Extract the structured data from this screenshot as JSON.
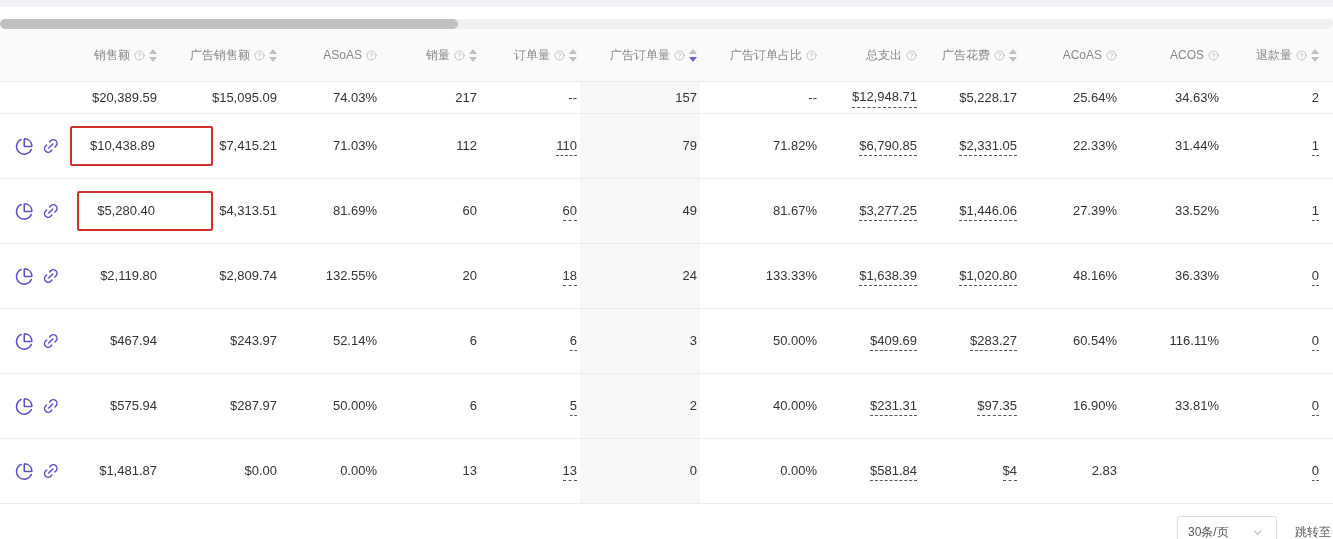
{
  "columns": [
    {
      "label": "销售额",
      "sortable": true,
      "sorted": false
    },
    {
      "label": "广告销售额",
      "sortable": true,
      "sorted": false
    },
    {
      "label": "ASoAS",
      "sortable": false
    },
    {
      "label": "销量",
      "sortable": true,
      "sorted": false
    },
    {
      "label": "订单量",
      "sortable": true,
      "sorted": false
    },
    {
      "label": "广告订单量",
      "sortable": true,
      "sorted": true
    },
    {
      "label": "广告订单占比",
      "sortable": false
    },
    {
      "label": "总支出",
      "sortable": false
    },
    {
      "label": "广告花费",
      "sortable": true,
      "sorted": false
    },
    {
      "label": "ACoAS",
      "sortable": false
    },
    {
      "label": "ACOS",
      "sortable": false
    },
    {
      "label": "退款量",
      "sortable": true,
      "sorted": false
    }
  ],
  "summary": [
    {
      "text": "$20,389.59",
      "dashed": false
    },
    {
      "text": "$15,095.09",
      "dashed": false
    },
    {
      "text": "74.03%",
      "dashed": false
    },
    {
      "text": "217",
      "dashed": false
    },
    {
      "text": "--",
      "dashed": false
    },
    {
      "text": "157",
      "dashed": false
    },
    {
      "text": "--",
      "dashed": false
    },
    {
      "text": "$12,948.71",
      "dashed": true
    },
    {
      "text": "$5,228.17",
      "dashed": false
    },
    {
      "text": "25.64%",
      "dashed": false
    },
    {
      "text": "34.63%",
      "dashed": false
    },
    {
      "text": "2",
      "dashed": false
    }
  ],
  "rows": [
    {
      "highlighted": true,
      "cells": [
        {
          "text": "$10,438.89",
          "dashed": false
        },
        {
          "text": "$7,415.21",
          "dashed": false
        },
        {
          "text": "71.03%",
          "dashed": false
        },
        {
          "text": "112",
          "dashed": false
        },
        {
          "text": "110",
          "dashed": true
        },
        {
          "text": "79",
          "dashed": false
        },
        {
          "text": "71.82%",
          "dashed": false
        },
        {
          "text": "$6,790.85",
          "dashed": true
        },
        {
          "text": "$2,331.05",
          "dashed": true
        },
        {
          "text": "22.33%",
          "dashed": false
        },
        {
          "text": "31.44%",
          "dashed": false
        },
        {
          "text": "1",
          "dashed": true
        }
      ]
    },
    {
      "highlighted": true,
      "cells": [
        {
          "text": "$5,280.40",
          "dashed": false
        },
        {
          "text": "$4,313.51",
          "dashed": false
        },
        {
          "text": "81.69%",
          "dashed": false
        },
        {
          "text": "60",
          "dashed": false
        },
        {
          "text": "60",
          "dashed": true
        },
        {
          "text": "49",
          "dashed": false
        },
        {
          "text": "81.67%",
          "dashed": false
        },
        {
          "text": "$3,277.25",
          "dashed": true
        },
        {
          "text": "$1,446.06",
          "dashed": true
        },
        {
          "text": "27.39%",
          "dashed": false
        },
        {
          "text": "33.52%",
          "dashed": false
        },
        {
          "text": "1",
          "dashed": true
        }
      ]
    },
    {
      "highlighted": false,
      "cells": [
        {
          "text": "$2,119.80",
          "dashed": false
        },
        {
          "text": "$2,809.74",
          "dashed": false
        },
        {
          "text": "132.55%",
          "dashed": false
        },
        {
          "text": "20",
          "dashed": false
        },
        {
          "text": "18",
          "dashed": true
        },
        {
          "text": "24",
          "dashed": false
        },
        {
          "text": "133.33%",
          "dashed": false
        },
        {
          "text": "$1,638.39",
          "dashed": true
        },
        {
          "text": "$1,020.80",
          "dashed": true
        },
        {
          "text": "48.16%",
          "dashed": false
        },
        {
          "text": "36.33%",
          "dashed": false
        },
        {
          "text": "0",
          "dashed": true
        }
      ]
    },
    {
      "highlighted": false,
      "cells": [
        {
          "text": "$467.94",
          "dashed": false
        },
        {
          "text": "$243.97",
          "dashed": false
        },
        {
          "text": "52.14%",
          "dashed": false
        },
        {
          "text": "6",
          "dashed": false
        },
        {
          "text": "6",
          "dashed": true
        },
        {
          "text": "3",
          "dashed": false
        },
        {
          "text": "50.00%",
          "dashed": false
        },
        {
          "text": "$409.69",
          "dashed": true
        },
        {
          "text": "$283.27",
          "dashed": true
        },
        {
          "text": "60.54%",
          "dashed": false
        },
        {
          "text": "116.11%",
          "dashed": false
        },
        {
          "text": "0",
          "dashed": true
        }
      ]
    },
    {
      "highlighted": false,
      "cells": [
        {
          "text": "$575.94",
          "dashed": false
        },
        {
          "text": "$287.97",
          "dashed": false
        },
        {
          "text": "50.00%",
          "dashed": false
        },
        {
          "text": "6",
          "dashed": false
        },
        {
          "text": "5",
          "dashed": true
        },
        {
          "text": "2",
          "dashed": false
        },
        {
          "text": "40.00%",
          "dashed": false
        },
        {
          "text": "$231.31",
          "dashed": true
        },
        {
          "text": "$97.35",
          "dashed": true
        },
        {
          "text": "16.90%",
          "dashed": false
        },
        {
          "text": "33.81%",
          "dashed": false
        },
        {
          "text": "0",
          "dashed": true
        }
      ]
    },
    {
      "highlighted": false,
      "cells": [
        {
          "text": "$1,481.87",
          "dashed": false
        },
        {
          "text": "$0.00",
          "dashed": false
        },
        {
          "text": "0.00%",
          "dashed": false
        },
        {
          "text": "13",
          "dashed": false
        },
        {
          "text": "13",
          "dashed": true
        },
        {
          "text": "0",
          "dashed": false
        },
        {
          "text": "0.00%",
          "dashed": false
        },
        {
          "text": "$581.84",
          "dashed": true
        },
        {
          "text": "$4",
          "dashed": true
        },
        {
          "text": "2.83",
          "dashed": false
        },
        null,
        {
          "text": "0",
          "dashed": true
        }
      ]
    }
  ],
  "pagination": {
    "page_size": "30条/页",
    "jump_label": "跳转至"
  }
}
